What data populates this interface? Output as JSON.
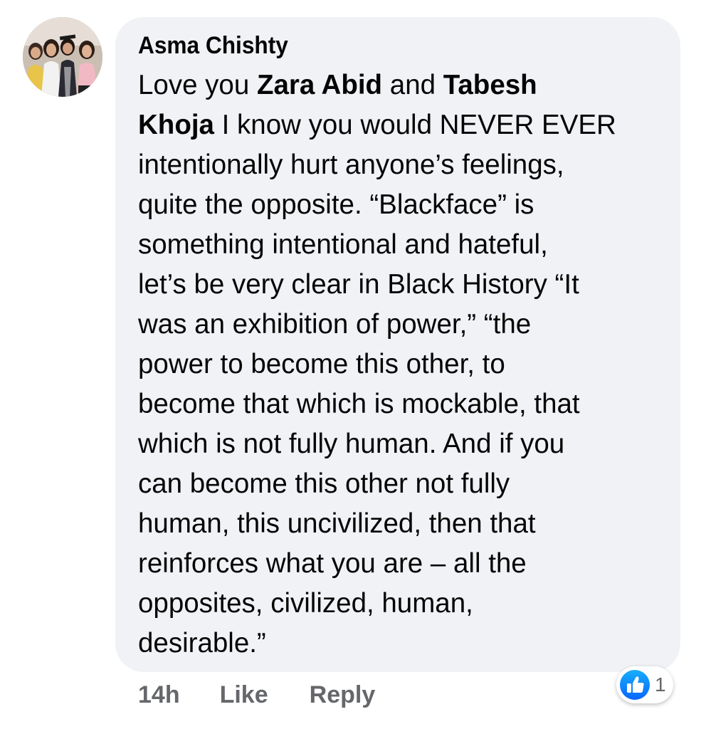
{
  "comment": {
    "author": "Asma Chishty",
    "lines": [
      [
        {
          "t": "Love you ",
          "b": false
        },
        {
          "t": "Zara Abid",
          "b": true
        },
        {
          "t": " and ",
          "b": false
        },
        {
          "t": "Tabesh",
          "b": true
        }
      ],
      [
        {
          "t": "Khoja",
          "b": true
        },
        {
          "t": " I know you would NEVER EVER",
          "b": false
        }
      ],
      [
        {
          "t": "intentionally hurt anyone’s feelings,",
          "b": false
        }
      ],
      [
        {
          "t": "quite the opposite. “Blackface” is",
          "b": false
        }
      ],
      [
        {
          "t": "something intentional and hateful,",
          "b": false
        }
      ],
      [
        {
          "t": "let’s be very clear in Black History “It",
          "b": false
        }
      ],
      [
        {
          "t": "was an exhibition of power,” “the",
          "b": false
        }
      ],
      [
        {
          "t": "power to become this other, to",
          "b": false
        }
      ],
      [
        {
          "t": "become that which is mockable, that",
          "b": false
        }
      ],
      [
        {
          "t": "which is not fully human. And if you",
          "b": false
        }
      ],
      [
        {
          "t": "can become this other not fully",
          "b": false
        }
      ],
      [
        {
          "t": "human, this uncivilized, then that",
          "b": false
        }
      ],
      [
        {
          "t": "reinforces what you are – all the",
          "b": false
        }
      ],
      [
        {
          "t": "opposites, civilized, human,",
          "b": false
        }
      ],
      [
        {
          "t": "desirable.”",
          "b": false
        }
      ]
    ],
    "timestamp": "14h",
    "like_label": "Like",
    "reply_label": "Reply",
    "reaction_count": "1",
    "reaction_icon": "thumbs-up-icon"
  },
  "colors": {
    "bubble": "#f0f2f5",
    "text": "#050505",
    "secondary_text": "#65676b",
    "like_blue": "#1877f2"
  }
}
